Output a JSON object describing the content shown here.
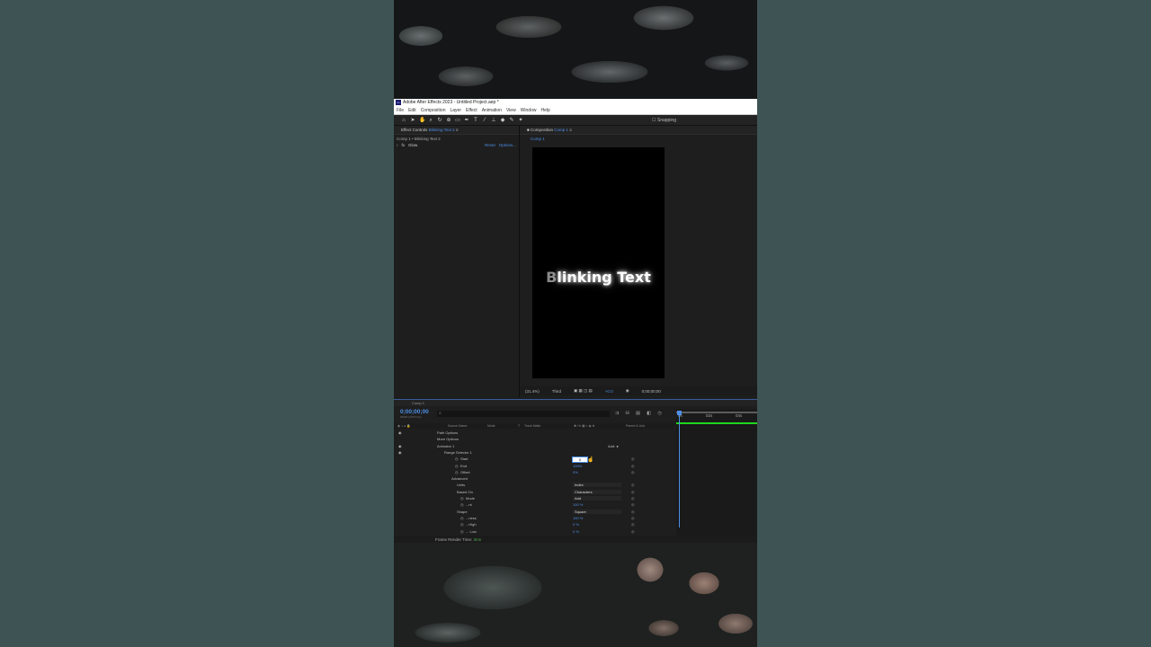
{
  "app": {
    "title": "Adobe After Effects 2023 - Untitled Project.aep *",
    "menu": [
      "File",
      "Edit",
      "Composition",
      "Layer",
      "Effect",
      "Animation",
      "View",
      "Window",
      "Help"
    ],
    "snapping": "Snapping"
  },
  "effect_controls": {
    "tab": "Effect Controls",
    "layer": "Blinking Text 2",
    "breadcrumb": "Comp 1 • Blinking Text 2",
    "effect_name": "Glow",
    "reset": "Reset",
    "options": "Options..."
  },
  "composition": {
    "tab": "Composition",
    "comp": "Comp 1",
    "crumb": "Comp 1",
    "text_first": "B",
    "text_rest": "linking Text",
    "zoom": "(31.4%)",
    "resolution": "Third",
    "exposure": "+0.0",
    "timecode": "0;00;00;00"
  },
  "timeline": {
    "tab": "Comp 1",
    "time": "0;00;00;00",
    "fps": "00000 (29.97 fps)",
    "search_placeholder": "",
    "columns": {
      "source": "Source Name",
      "mode": "Mode",
      "t": "T",
      "trackmatte": "Track Matte",
      "parent": "Parent & Link"
    },
    "ruler": [
      "0s",
      "02s",
      "04s"
    ],
    "rows": [
      {
        "name": "Path Options",
        "indent": 48
      },
      {
        "name": "More Options",
        "indent": 48
      },
      {
        "name": "Animator 1",
        "indent": 48,
        "add": "Add:"
      },
      {
        "name": "Range Selector 1",
        "indent": 56
      },
      {
        "name": "Start",
        "indent": 74,
        "stopwatch": true,
        "value": "0"
      },
      {
        "name": "End",
        "indent": 74,
        "stopwatch": true,
        "value": "100%"
      },
      {
        "name": "Offset",
        "indent": 74,
        "stopwatch": true,
        "value": "0%"
      },
      {
        "name": "Advanced",
        "indent": 64
      },
      {
        "name": "Units",
        "indent": 70,
        "select": "Index"
      },
      {
        "name": "Based On",
        "indent": 70,
        "select": "Characters"
      },
      {
        "name": "Mode",
        "indent": 80,
        "stopwatch": true,
        "select": "Add"
      },
      {
        "name": "...nt",
        "indent": 80,
        "stopwatch": true,
        "value": "100 %"
      },
      {
        "name": "Shape",
        "indent": 70,
        "select": "Square"
      },
      {
        "name": "...ness",
        "indent": 80,
        "stopwatch": true,
        "value": "100 %"
      },
      {
        "name": "...High",
        "indent": 80,
        "stopwatch": true,
        "value": "0 %"
      },
      {
        "name": "... Low",
        "indent": 80,
        "stopwatch": true,
        "value": "0 %"
      },
      {
        "name": "Random...",
        "indent": 70,
        "value": "Off"
      }
    ],
    "status_label": "Frame Render Time:",
    "status_value": "3ms"
  },
  "colors": {
    "accent": "#4d8fe6",
    "background": "#3e5454",
    "panel": "#1e1e1e"
  }
}
